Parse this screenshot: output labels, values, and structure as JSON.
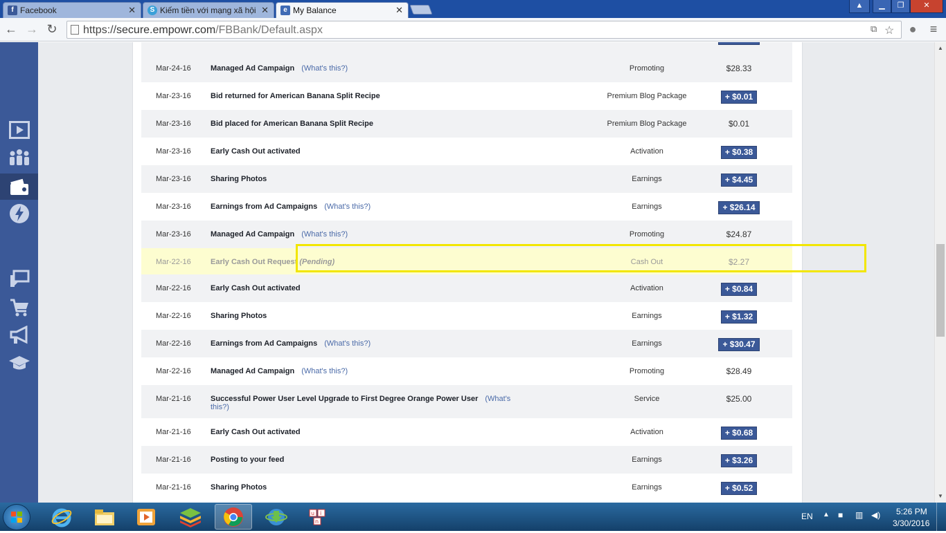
{
  "browser": {
    "tabs": [
      {
        "title": "Facebook",
        "icon": "facebook-icon",
        "active": false
      },
      {
        "title": "Kiếm tiền với mạng xã hội",
        "icon": "empowr-icon",
        "active": false
      },
      {
        "title": "My Balance",
        "icon": "empowr-e-icon",
        "active": true
      }
    ],
    "url": {
      "scheme": "https://",
      "host": "secure.empowr.com",
      "path": "/FBBank/Default.aspx"
    }
  },
  "sidebar": {
    "items": [
      {
        "icon": "video-play-icon",
        "active": false
      },
      {
        "icon": "people-group-icon",
        "active": false
      },
      {
        "icon": "wallet-icon",
        "active": true
      },
      {
        "icon": "lightning-icon",
        "active": false
      },
      {
        "icon": "feedback-icon",
        "active": false
      },
      {
        "icon": "shopping-cart-icon",
        "active": false
      },
      {
        "icon": "megaphone-icon",
        "active": false
      },
      {
        "icon": "graduation-cap-icon",
        "active": false
      }
    ]
  },
  "transactions": {
    "whats_this": "(What's this?)",
    "rows": [
      {
        "date": "Mar-24-16",
        "description": "Managed Ad Campaign",
        "whats_this": true,
        "category": "Promoting",
        "amount": "$28.33",
        "credit": false
      },
      {
        "date": "Mar-23-16",
        "description": "Bid returned for American Banana Split Recipe",
        "whats_this": false,
        "category": "Premium Blog Package",
        "amount": "+ $0.01",
        "credit": true
      },
      {
        "date": "Mar-23-16",
        "description": "Bid placed for American Banana Split Recipe",
        "whats_this": false,
        "category": "Premium Blog Package",
        "amount": "$0.01",
        "credit": false
      },
      {
        "date": "Mar-23-16",
        "description": "Early Cash Out activated",
        "whats_this": false,
        "category": "Activation",
        "amount": "+ $0.38",
        "credit": true
      },
      {
        "date": "Mar-23-16",
        "description": "Sharing Photos",
        "whats_this": false,
        "category": "Earnings",
        "amount": "+ $4.45",
        "credit": true
      },
      {
        "date": "Mar-23-16",
        "description": "Earnings from Ad Campaigns",
        "whats_this": true,
        "category": "Earnings",
        "amount": "+ $26.14",
        "credit": true
      },
      {
        "date": "Mar-23-16",
        "description": "Managed Ad Campaign",
        "whats_this": true,
        "category": "Promoting",
        "amount": "$24.87",
        "credit": false
      },
      {
        "date": "Mar-22-16",
        "description": "Early Cash Out Request",
        "pending_label": "(Pending)",
        "whats_this": false,
        "category": "Cash Out",
        "amount": "$2.27",
        "credit": false,
        "pending": true
      },
      {
        "date": "Mar-22-16",
        "description": "Early Cash Out activated",
        "whats_this": false,
        "category": "Activation",
        "amount": "+ $0.84",
        "credit": true
      },
      {
        "date": "Mar-22-16",
        "description": "Sharing Photos",
        "whats_this": false,
        "category": "Earnings",
        "amount": "+ $1.32",
        "credit": true
      },
      {
        "date": "Mar-22-16",
        "description": "Earnings from Ad Campaigns",
        "whats_this": true,
        "category": "Earnings",
        "amount": "+ $30.47",
        "credit": true
      },
      {
        "date": "Mar-22-16",
        "description": "Managed Ad Campaign",
        "whats_this": true,
        "category": "Promoting",
        "amount": "$28.49",
        "credit": false
      },
      {
        "date": "Mar-21-16",
        "description": "Successful Power User Level Upgrade to First Degree Orange Power User",
        "whats_this": true,
        "category": "Service",
        "amount": "$25.00",
        "credit": false
      },
      {
        "date": "Mar-21-16",
        "description": "Early Cash Out activated",
        "whats_this": false,
        "category": "Activation",
        "amount": "+ $0.68",
        "credit": true
      },
      {
        "date": "Mar-21-16",
        "description": "Posting to your feed",
        "whats_this": false,
        "category": "Earnings",
        "amount": "+ $3.26",
        "credit": true
      },
      {
        "date": "Mar-21-16",
        "description": "Sharing Photos",
        "whats_this": false,
        "category": "Earnings",
        "amount": "+ $0.52",
        "credit": true
      }
    ]
  },
  "taskbar": {
    "apps": [
      "internet-explorer-icon",
      "file-explorer-icon",
      "media-player-icon",
      "bluestacks-icon",
      "chrome-icon",
      "download-manager-icon",
      "unikey-icon"
    ],
    "language": "EN",
    "time": "5:26 PM",
    "date": "3/30/2016"
  },
  "colors": {
    "accent": "#3b5998",
    "highlight_border": "#f2e600",
    "pending_bg": "#fdfdd0"
  }
}
